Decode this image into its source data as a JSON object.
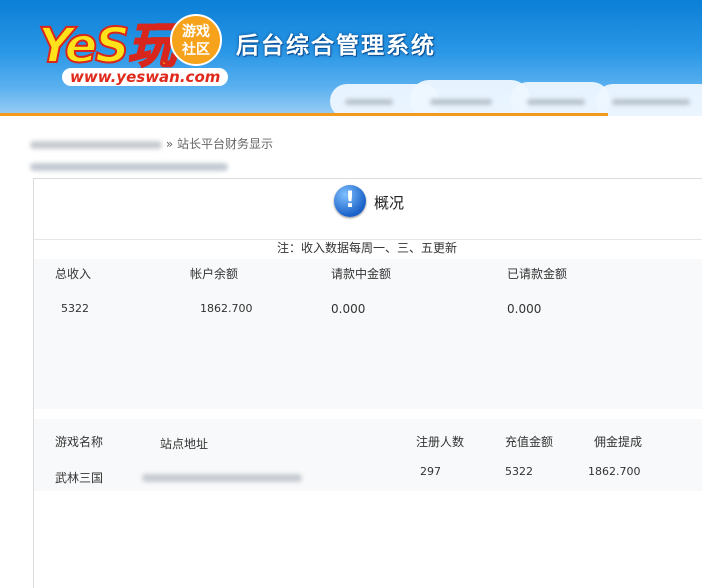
{
  "header": {
    "logo_text": "YeS玩",
    "logo_badge_line1": "游戏",
    "logo_badge_line2": "社区",
    "logo_url": "www.yeswan.com",
    "system_title": "后台综合管理系统"
  },
  "breadcrumb": {
    "separator": "»",
    "current": "站长平台财务显示"
  },
  "panel": {
    "icon": "info-icon",
    "title": "概况",
    "note": "注：收入数据每周一、三、五更新"
  },
  "summary": {
    "headers": [
      "总收入",
      "帐户余额",
      "请款中金额",
      "已请款金额"
    ],
    "values": [
      "5322",
      "1862.700",
      "0.000",
      "0.000"
    ]
  },
  "games": {
    "headers": [
      "游戏名称",
      "站点地址",
      "注册人数",
      "充值金额",
      "佣金提成"
    ],
    "rows": [
      {
        "name": "武林三国",
        "site": "",
        "registered": "297",
        "recharge": "5322",
        "commission": "1862.700"
      }
    ]
  },
  "colors": {
    "header_blue": "#0b7fd6",
    "accent_orange": "#f39a1e",
    "info_blue": "#1a62c8"
  }
}
